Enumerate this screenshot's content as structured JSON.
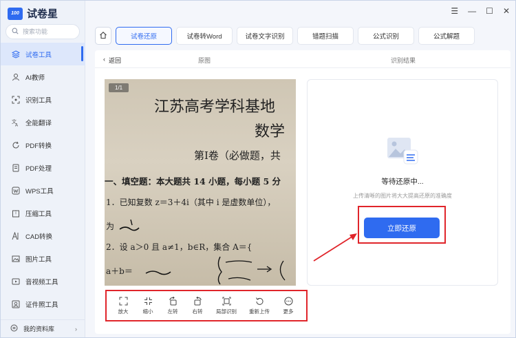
{
  "app": {
    "name": "试卷星",
    "logo_badge": "100"
  },
  "search": {
    "placeholder": "搜索功能"
  },
  "sidebar": {
    "items": [
      {
        "label": "试卷工具",
        "icon": "layers-icon"
      },
      {
        "label": "AI教师",
        "icon": "teacher-icon"
      },
      {
        "label": "识别工具",
        "icon": "scan-icon"
      },
      {
        "label": "全能翻译",
        "icon": "translate-icon"
      },
      {
        "label": "PDF转换",
        "icon": "refresh-icon"
      },
      {
        "label": "PDF处理",
        "icon": "document-icon"
      },
      {
        "label": "WPS工具",
        "icon": "wps-icon"
      },
      {
        "label": "压缩工具",
        "icon": "compress-icon"
      },
      {
        "label": "CAD转换",
        "icon": "cad-icon"
      },
      {
        "label": "图片工具",
        "icon": "image-icon"
      },
      {
        "label": "音视频工具",
        "icon": "media-icon"
      },
      {
        "label": "证件照工具",
        "icon": "id-photo-icon"
      }
    ],
    "active_index": 0,
    "footer": "我的资料库"
  },
  "tabs": [
    {
      "label": "试卷还原",
      "active": true
    },
    {
      "label": "试卷转Word",
      "active": false
    },
    {
      "label": "试卷文字识别",
      "active": false
    },
    {
      "label": "错题扫描",
      "active": false
    },
    {
      "label": "公式识别",
      "active": false
    },
    {
      "label": "公式解题",
      "active": false
    }
  ],
  "subheader": {
    "back": "返回",
    "original": "原图",
    "result": "识别结果"
  },
  "photo": {
    "page_indicator": "1/1",
    "lines": [
      "江苏高考学科基地",
      "数学",
      "第Ⅰ卷（必做题，共",
      "一、填空题：本大题共 14 小题，每小题 5 分",
      "1．已知复数 z＝3＋4i（其中 i 是虚数单位），",
      "为",
      "2．设 a＞0 且 a≠1，b∈R，集合 A＝{",
      "a＋b＝"
    ]
  },
  "toolbar": {
    "tools": [
      {
        "label": "放大",
        "icon": "zoom-in-icon"
      },
      {
        "label": "缩小",
        "icon": "zoom-out-icon"
      },
      {
        "label": "左转",
        "icon": "rotate-left-icon"
      },
      {
        "label": "右转",
        "icon": "rotate-right-icon"
      },
      {
        "label": "局部识别",
        "icon": "crop-icon"
      },
      {
        "label": "重新上传",
        "icon": "reupload-icon"
      },
      {
        "label": "更多",
        "icon": "more-icon"
      }
    ]
  },
  "result": {
    "status": "等待还原中...",
    "hint": "上传清晰的图片将大大提高还原的准确度",
    "button": "立即还原"
  },
  "colors": {
    "accent": "#2f6bf0",
    "highlight": "#e0242a"
  }
}
